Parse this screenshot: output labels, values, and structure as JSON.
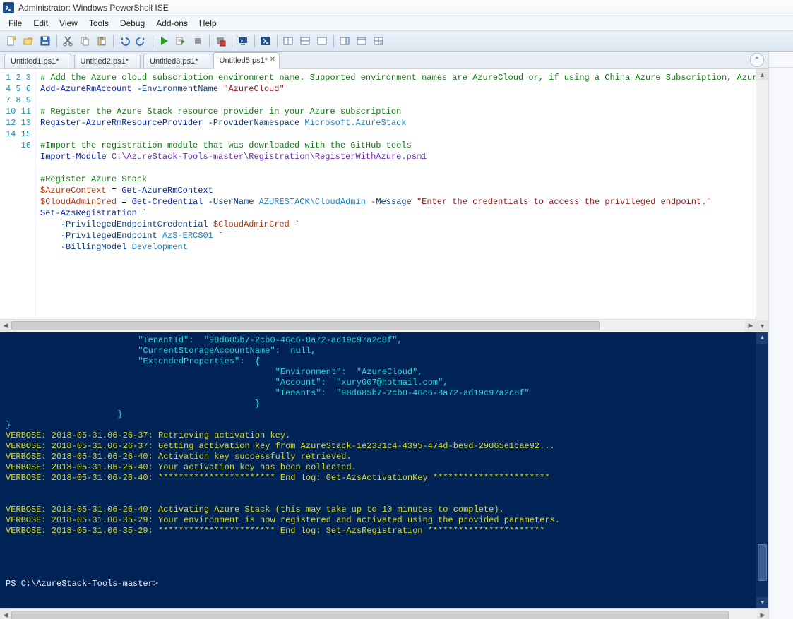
{
  "window": {
    "title": "Administrator: Windows PowerShell ISE"
  },
  "menubar": {
    "items": [
      "File",
      "Edit",
      "View",
      "Tools",
      "Debug",
      "Add-ons",
      "Help"
    ]
  },
  "toolbar": {
    "groups": [
      [
        "new-file-icon",
        "open-file-icon",
        "save-icon"
      ],
      [
        "cut-icon",
        "copy-icon",
        "paste-icon"
      ],
      [
        "undo-icon",
        "redo-icon"
      ],
      [
        "run-icon",
        "run-selection-icon",
        "stop-icon"
      ],
      [
        "stop-debugger-icon"
      ],
      [
        "remote-icon"
      ],
      [
        "powershell-icon"
      ],
      [
        "layout-sbs-icon",
        "layout-top-icon",
        "layout-max-icon"
      ],
      [
        "cmd-addon-icon",
        "options-icon",
        "help-icon"
      ]
    ]
  },
  "tabs": [
    {
      "label": "Untitled1.ps1*",
      "active": false
    },
    {
      "label": "Untitled2.ps1*",
      "active": false
    },
    {
      "label": "Untitled3.ps1*",
      "active": false
    },
    {
      "label": "Untitled5.ps1*",
      "active": true
    }
  ],
  "editor": {
    "line_count": 16,
    "lines": [
      [
        [
          "comment",
          "# Add the Azure cloud subscription environment name. Supported environment names are AzureCloud or, if using a China Azure Subscription, Azure"
        ]
      ],
      [
        [
          "cmd",
          "Add-AzureRmAccount"
        ],
        [
          "plain",
          " "
        ],
        [
          "param",
          "-EnvironmentName"
        ],
        [
          "plain",
          " "
        ],
        [
          "str",
          "\"AzureCloud\""
        ]
      ],
      [],
      [
        [
          "comment",
          "# Register the Azure Stack resource provider in your Azure subscription"
        ]
      ],
      [
        [
          "cmd",
          "Register-AzureRmResourceProvider"
        ],
        [
          "plain",
          " "
        ],
        [
          "param",
          "-ProviderNamespace"
        ],
        [
          "plain",
          " "
        ],
        [
          "type",
          "Microsoft.AzureStack"
        ]
      ],
      [],
      [
        [
          "comment",
          "#Import the registration module that was downloaded with the GitHub tools"
        ]
      ],
      [
        [
          "cmd",
          "Import-Module"
        ],
        [
          "plain",
          " "
        ],
        [
          "path",
          "C:\\AzureStack-Tools-master\\Registration\\RegisterWithAzure.psm1"
        ]
      ],
      [],
      [
        [
          "comment",
          "#Register Azure Stack"
        ]
      ],
      [
        [
          "var",
          "$AzureContext"
        ],
        [
          "plain",
          " = "
        ],
        [
          "cmd",
          "Get-AzureRmContext"
        ]
      ],
      [
        [
          "var",
          "$CloudAdminCred"
        ],
        [
          "plain",
          " = "
        ],
        [
          "cmd",
          "Get-Credential"
        ],
        [
          "plain",
          " "
        ],
        [
          "param",
          "-UserName"
        ],
        [
          "plain",
          " "
        ],
        [
          "type",
          "AZURESTACK\\CloudAdmin"
        ],
        [
          "plain",
          " "
        ],
        [
          "param",
          "-Message"
        ],
        [
          "plain",
          " "
        ],
        [
          "str",
          "\"Enter the credentials to access the privileged endpoint.\""
        ]
      ],
      [
        [
          "cmd",
          "Set-AzsRegistration"
        ],
        [
          "plain",
          " `"
        ]
      ],
      [
        [
          "plain",
          "    "
        ],
        [
          "param",
          "-PrivilegedEndpointCredential"
        ],
        [
          "plain",
          " "
        ],
        [
          "var",
          "$CloudAdminCred"
        ],
        [
          "plain",
          " `"
        ]
      ],
      [
        [
          "plain",
          "    "
        ],
        [
          "param",
          "-PrivilegedEndpoint"
        ],
        [
          "plain",
          " "
        ],
        [
          "type",
          "AzS-ERCS01"
        ],
        [
          "plain",
          " `"
        ]
      ],
      [
        [
          "plain",
          "    "
        ],
        [
          "param",
          "-BillingModel"
        ],
        [
          "plain",
          " "
        ],
        [
          "type",
          "Development"
        ]
      ]
    ]
  },
  "console": {
    "lines": [
      [
        [
          "cyan",
          "                          \"TenantId\":  \"98d685b7-2cb0-46c6-8a72-ad19c97a2c8f\","
        ]
      ],
      [
        [
          "cyan",
          "                          \"CurrentStorageAccountName\":  null,"
        ]
      ],
      [
        [
          "cyan",
          "                          \"ExtendedProperties\":  {"
        ]
      ],
      [
        [
          "cyan",
          "                                                     \"Environment\":  \"AzureCloud\","
        ]
      ],
      [
        [
          "cyan",
          "                                                     \"Account\":  \"xury007@hotmail.com\","
        ]
      ],
      [
        [
          "cyan",
          "                                                     \"Tenants\":  \"98d685b7-2cb0-46c6-8a72-ad19c97a2c8f\""
        ]
      ],
      [
        [
          "cyan",
          "                                                 }"
        ]
      ],
      [
        [
          "cyan",
          "                      }"
        ]
      ],
      [
        [
          "cyan",
          "}"
        ]
      ],
      [
        [
          "yel",
          "VERBOSE: 2018-05-31.06-26-37: Retrieving activation key."
        ]
      ],
      [
        [
          "yel",
          "VERBOSE: 2018-05-31.06-26-37: Getting activation key from AzureStack-1e2331c4-4395-474d-be9d-29065e1cae92..."
        ]
      ],
      [
        [
          "yel",
          "VERBOSE: 2018-05-31.06-26-40: Activation key successfully retrieved."
        ]
      ],
      [
        [
          "yel",
          "VERBOSE: 2018-05-31.06-26-40: Your activation key has been collected."
        ]
      ],
      [
        [
          "yel",
          "VERBOSE: 2018-05-31.06-26-40: *********************** End log: Get-AzsActivationKey ***********************"
        ]
      ],
      [
        [
          "plain",
          ""
        ]
      ],
      [
        [
          "plain",
          ""
        ]
      ],
      [
        [
          "yel",
          "VERBOSE: 2018-05-31.06-26-40: Activating Azure Stack (this may take up to 10 minutes to complete)."
        ]
      ],
      [
        [
          "yel",
          "VERBOSE: 2018-05-31.06-35-29: Your environment is now registered and activated using the provided parameters."
        ]
      ],
      [
        [
          "yel",
          "VERBOSE: 2018-05-31.06-35-29: *********************** End log: Set-AzsRegistration ***********************"
        ]
      ],
      [
        [
          "plain",
          ""
        ]
      ],
      [
        [
          "plain",
          ""
        ]
      ],
      [
        [
          "plain",
          ""
        ]
      ],
      [
        [
          "plain",
          ""
        ]
      ],
      [
        [
          "plain",
          "PS C:\\AzureStack-Tools-master> "
        ]
      ]
    ]
  }
}
